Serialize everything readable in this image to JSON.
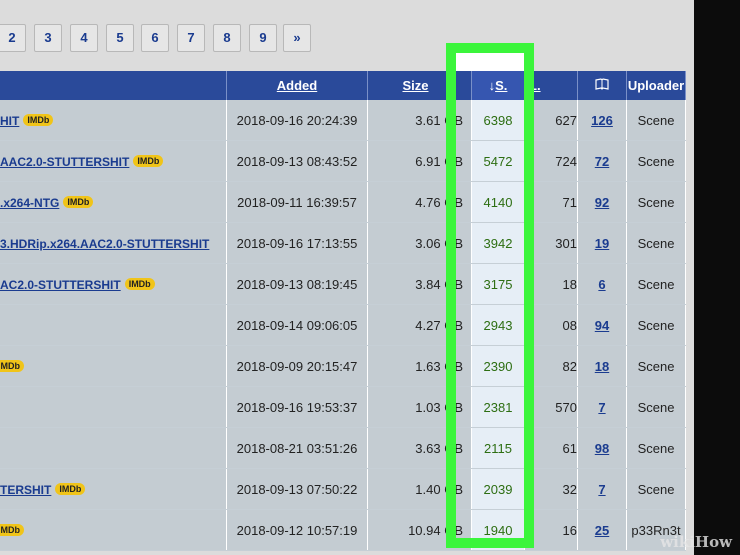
{
  "pagination": [
    "2",
    "3",
    "4",
    "5",
    "6",
    "7",
    "8",
    "9",
    "»"
  ],
  "table": {
    "headers": {
      "added": "Added",
      "size": "Size",
      "seeders": "S.",
      "leechers": "L.",
      "comments_icon": "book-icon",
      "uploader": "Uploader"
    },
    "rows": [
      {
        "name": "HIT",
        "imdb": true,
        "added": "2018-09-16 20:24:39",
        "size": "3.61 GB",
        "seeders": "6398",
        "leechers": "627",
        "comments": "126",
        "uploader": "Scene"
      },
      {
        "name": "AAC2.0-STUTTERSHIT",
        "imdb": true,
        "added": "2018-09-13 08:43:52",
        "size": "6.91 GB",
        "seeders": "5472",
        "leechers": "724",
        "comments": "72",
        "uploader": "Scene"
      },
      {
        "name": ".x264-NTG",
        "imdb": true,
        "added": "2018-09-11 16:39:57",
        "size": "4.76 GB",
        "seeders": "4140",
        "leechers": "71",
        "comments": "92",
        "uploader": "Scene"
      },
      {
        "name": "3.HDRip.x264.AAC2.0-STUTTERSHIT",
        "imdb": false,
        "added": "2018-09-16 17:13:55",
        "size": "3.06 GB",
        "seeders": "3942",
        "leechers": "301",
        "comments": "19",
        "uploader": "Scene"
      },
      {
        "name": "AC2.0-STUTTERSHIT",
        "imdb": true,
        "added": "2018-09-13 08:19:45",
        "size": "3.84 GB",
        "seeders": "3175",
        "leechers": "18",
        "comments": "6",
        "uploader": "Scene"
      },
      {
        "name": "",
        "imdb": false,
        "added": "2018-09-14 09:06:05",
        "size": "4.27 GB",
        "seeders": "2943",
        "leechers": "08",
        "comments": "94",
        "uploader": "Scene"
      },
      {
        "name": "",
        "imdb": true,
        "added": "2018-09-09 20:15:47",
        "size": "1.63 GB",
        "seeders": "2390",
        "leechers": "82",
        "comments": "18",
        "uploader": "Scene"
      },
      {
        "name": "",
        "imdb": false,
        "added": "2018-09-16 19:53:37",
        "size": "1.03 GB",
        "seeders": "2381",
        "leechers": "570",
        "comments": "7",
        "uploader": "Scene"
      },
      {
        "name": "",
        "imdb": false,
        "added": "2018-08-21 03:51:26",
        "size": "3.63 GB",
        "seeders": "2115",
        "leechers": "61",
        "comments": "98",
        "uploader": "Scene"
      },
      {
        "name": "TERSHIT",
        "imdb": true,
        "added": "2018-09-13 07:50:22",
        "size": "1.40 GB",
        "seeders": "2039",
        "leechers": "32",
        "comments": "7",
        "uploader": "Scene"
      },
      {
        "name": "",
        "imdb": true,
        "added": "2018-09-12 10:57:19",
        "size": "10.94 GB",
        "seeders": "1940",
        "leechers": "16",
        "comments": "25",
        "uploader": "p33Rn3t"
      }
    ],
    "imdb_badge": "IMDb",
    "sort_arrow": "↓"
  },
  "watermark": "wikiHow",
  "colors": {
    "header_bg": "#2a4a9a",
    "row_bg": "#c4ccd2",
    "link": "#1a3b8f",
    "seeders_text": "#2d6e12",
    "highlight": "#3bf53b",
    "imdb_badge": "#f0c419"
  }
}
